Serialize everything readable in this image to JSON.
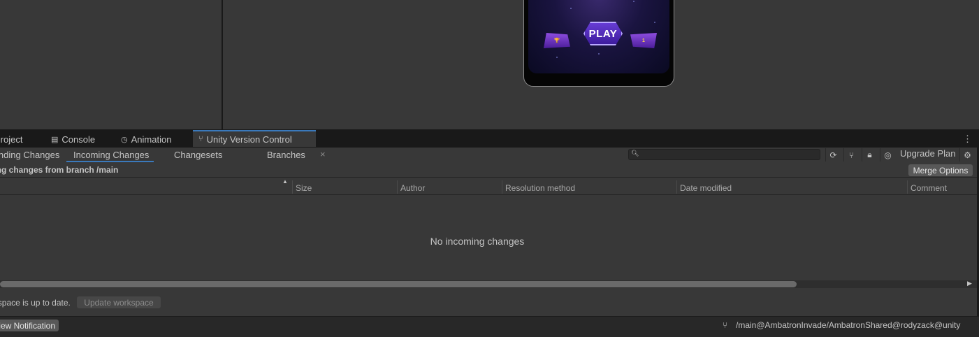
{
  "game_view": {
    "play_label": "PLAY",
    "left_badge": "🏆",
    "right_badge": "1"
  },
  "tabs": [
    {
      "label": "Project",
      "icon": "folder-icon"
    },
    {
      "label": "Console",
      "icon": "console-icon"
    },
    {
      "label": "Animation",
      "icon": "animation-icon"
    },
    {
      "label": "Unity Version Control",
      "icon": "branch-icon",
      "active": true
    }
  ],
  "subtabs": {
    "pending": "Pending Changes",
    "incoming": "Incoming Changes",
    "changesets": "Changesets",
    "branches": "Branches",
    "close": "×"
  },
  "toolbar": {
    "search_placeholder": "",
    "upgrade_label": "Upgrade Plan"
  },
  "header": {
    "branch_title": "Incoming changes from branch /main",
    "merge_label": "Merge Options"
  },
  "columns": [
    "Size",
    "Author",
    "Resolution method",
    "Date modified",
    "Comment"
  ],
  "list": {
    "empty_message": "No incoming changes"
  },
  "status": {
    "text": "Workspace is up to date.",
    "update_label": "Update workspace"
  },
  "footer": {
    "notification_label": "View Notification",
    "workspace_path": "/main@AmbatronInvade/AmbatronShared@rodyzack@unity"
  },
  "colors": {
    "accent": "#3a79bb",
    "panel": "#383838",
    "dark": "#191919"
  }
}
